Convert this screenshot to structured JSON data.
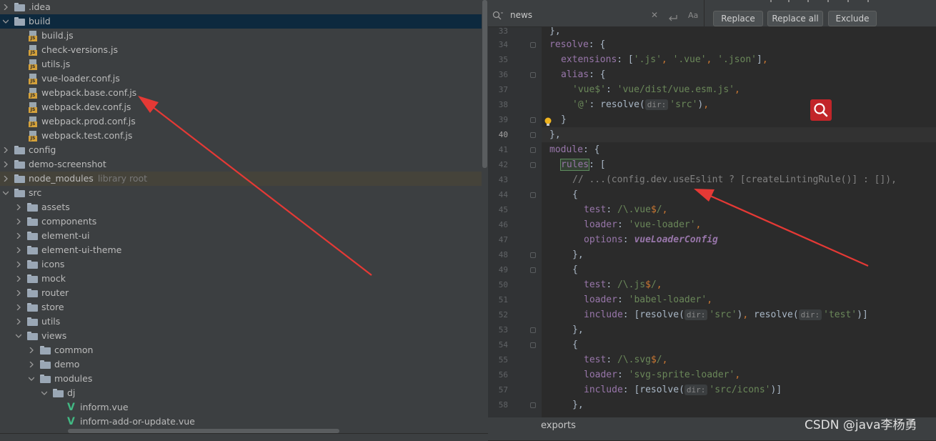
{
  "tree": {
    "items": [
      {
        "label": "▸.idea",
        "name": ".idea"
      },
      {
        "name": "build"
      },
      {
        "name": "build.js"
      },
      {
        "name": "check-versions.js"
      },
      {
        "name": "utils.js"
      },
      {
        "name": "vue-loader.conf.js"
      },
      {
        "name": "webpack.base.conf.js"
      },
      {
        "name": "webpack.dev.conf.js"
      },
      {
        "name": "webpack.prod.conf.js"
      },
      {
        "name": "webpack.test.conf.js"
      },
      {
        "name": "config"
      },
      {
        "name": "demo-screenshot"
      },
      {
        "name": "node_modules",
        "sub": "library root"
      },
      {
        "name": "src"
      },
      {
        "name": "assets"
      },
      {
        "name": "components"
      },
      {
        "name": "element-ui"
      },
      {
        "name": "element-ui-theme"
      },
      {
        "name": "icons"
      },
      {
        "name": "mock"
      },
      {
        "name": "router"
      },
      {
        "name": "store"
      },
      {
        "name": "utils"
      },
      {
        "name": "views"
      },
      {
        "name": "common"
      },
      {
        "name": "demo"
      },
      {
        "name": "modules"
      },
      {
        "name": "dj"
      },
      {
        "name": "inform.vue"
      },
      {
        "name": "inform-add-or-update.vue"
      }
    ]
  },
  "findbar": {
    "search_text": "news",
    "close_symbol": "✕",
    "case_symbol": "Aa",
    "replace_label": "Replace",
    "replace_all_label": "Replace all",
    "exclude_label": "Exclude"
  },
  "editor": {
    "current_line": "40",
    "line_numbers": [
      "33",
      "34",
      "35",
      "36",
      "37",
      "38",
      "39",
      "40",
      "41",
      "42",
      "43",
      "44",
      "45",
      "46",
      "47",
      "48",
      "49",
      "50",
      "51",
      "52",
      "53",
      "54",
      "55",
      "56",
      "57",
      "58"
    ],
    "hint_dir": "dir:",
    "lines": {
      "l33": "},",
      "l34_key": "resolve",
      "l34_rest": ": {",
      "l35_key": "extensions",
      "l35_a": "'.js'",
      "l35_b": "'.vue'",
      "l35_c": "'.json'",
      "l36_key": "alias",
      "l36_rest": ": {",
      "l37_key": "'vue$'",
      "l37_val": "'vue/dist/vue.esm.js'",
      "l38_key": "'@'",
      "l38_fn": "resolve(",
      "l38_val": "'src'",
      "l39": "}",
      "l40": "},",
      "l41_key": "module",
      "l41_rest": ": {",
      "l42_key": "rules",
      "l42_rest": ": [",
      "l43": "// ...(config.dev.useEslint ? [createLintingRule()] : []),",
      "l44": "{",
      "l45_key": "test",
      "l45_val_a": "/\\.vue",
      "l45_val_b": "$",
      "l45_val_c": "/",
      "l46_key": "loader",
      "l46_val": "'vue-loader'",
      "l47_key": "options",
      "l47_val": "vueLoaderConfig",
      "l48": "},",
      "l49": "{",
      "l50_key": "test",
      "l50_val_a": "/\\.js",
      "l50_val_b": "$",
      "l50_val_c": "/",
      "l51_key": "loader",
      "l51_val": "'babel-loader'",
      "l52_key": "include",
      "l52_fn": "resolve(",
      "l52_val1": "'src'",
      "l52_fn2": "resolve(",
      "l52_val2": "'test'",
      "l53": "},",
      "l54": "{",
      "l55_key": "test",
      "l55_val_a": "/\\.svg",
      "l55_val_b": "$",
      "l55_val_c": "/",
      "l56_key": "loader",
      "l56_val": "'svg-sprite-loader'",
      "l57_key": "include",
      "l57_fn": "resolve(",
      "l57_val": "'src/icons'",
      "l58": "},"
    }
  },
  "breadcrumb": "exports",
  "watermark": "CSDN @java李杨勇",
  "colors": {
    "keyword": "#cc7832",
    "string": "#6a8759",
    "property": "#9876aa",
    "comment": "#808080",
    "function": "#ffc66d",
    "arrow": "#e53935",
    "selection": "#0d293e"
  },
  "icons": [
    "chevron-right-icon",
    "chevron-down-icon",
    "folder-icon",
    "js-file-icon",
    "vue-file-icon",
    "search-icon",
    "close-icon",
    "newline-icon",
    "match-case-icon",
    "bulb-icon",
    "magnifier-icon",
    "arrow-annotation"
  ]
}
